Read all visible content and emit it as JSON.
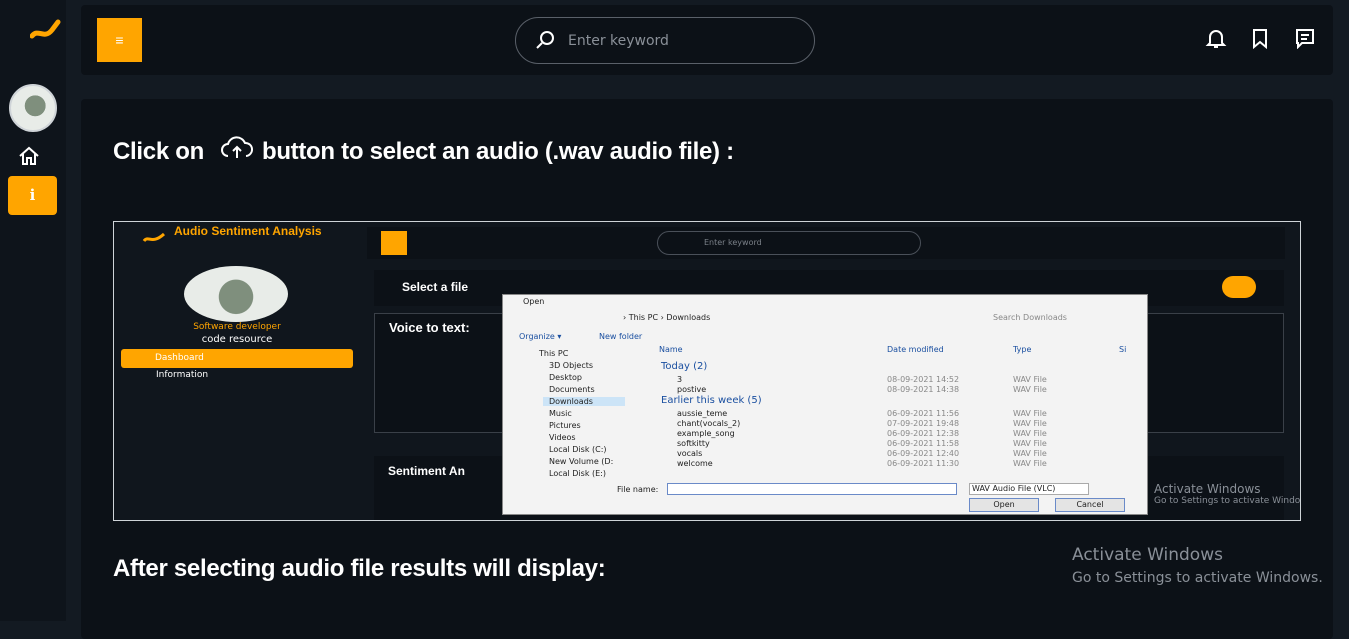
{
  "sidebar": {
    "logo": "logo-icon",
    "avatar": "avatar",
    "items": [
      {
        "name": "home",
        "icon": "home-icon"
      },
      {
        "name": "info",
        "icon": "info-icon",
        "label": "i",
        "active": true
      }
    ]
  },
  "topbar": {
    "menu_icon": "≡",
    "search_placeholder": "Enter keyword",
    "icons": [
      "bell-icon",
      "bookmark-icon",
      "message-icon"
    ]
  },
  "content": {
    "heading_before": "Click on",
    "heading_after": "button to select an audio (.wav audio file) :",
    "heading2": "After selecting audio file results will display:"
  },
  "embedded_screenshot": {
    "app_title": "Audio Sentiment Analysis",
    "role": "Software developer",
    "org": "code resource",
    "nav": [
      "Dashboard",
      "Information"
    ],
    "search_placeholder": "Enter keyword",
    "select_file": "Select a file",
    "voice_to_text": "Voice to text:",
    "sentiment": "Sentiment An",
    "dialog": {
      "title": "Open",
      "path": "› This PC › Downloads",
      "search": "Search Downloads",
      "organize": "Organize ▾",
      "new_folder": "New folder",
      "columns": [
        "Name",
        "Date modified",
        "Type",
        "Si"
      ],
      "tree": [
        "This PC",
        "3D Objects",
        "Desktop",
        "Documents",
        "Downloads",
        "Music",
        "Pictures",
        "Videos",
        "Local Disk (C:)",
        "New Volume (D:",
        "Local Disk (E:)"
      ],
      "group_today": "Today (2)",
      "group_week": "Earlier this week (5)",
      "files": [
        {
          "name": "3",
          "date": "08-09-2021 14:52",
          "type": "WAV File"
        },
        {
          "name": "postive",
          "date": "08-09-2021 14:38",
          "type": "WAV File"
        },
        {
          "name": "aussie_teme",
          "date": "06-09-2021 11:56",
          "type": "WAV File"
        },
        {
          "name": "chant(vocals_2)",
          "date": "07-09-2021 19:48",
          "type": "WAV File"
        },
        {
          "name": "example_song",
          "date": "06-09-2021 12:38",
          "type": "WAV File"
        },
        {
          "name": "softkitty",
          "date": "06-09-2021 11:58",
          "type": "WAV File"
        },
        {
          "name": "vocals",
          "date": "06-09-2021 12:40",
          "type": "WAV File"
        },
        {
          "name": "welcome",
          "date": "06-09-2021 11:30",
          "type": "WAV File"
        }
      ],
      "file_name_label": "File name:",
      "filter": "WAV Audio File (VLC)",
      "open_label": "Open",
      "cancel_label": "Cancel"
    },
    "watermark": "Activate Windows",
    "watermark_sub": "Go to Settings to activate Windows."
  },
  "watermark": {
    "title": "Activate Windows",
    "subtitle": "Go to Settings to activate Windows."
  },
  "colors": {
    "accent": "#ffa500",
    "bg": "#131a22",
    "panel": "#0c1117"
  }
}
